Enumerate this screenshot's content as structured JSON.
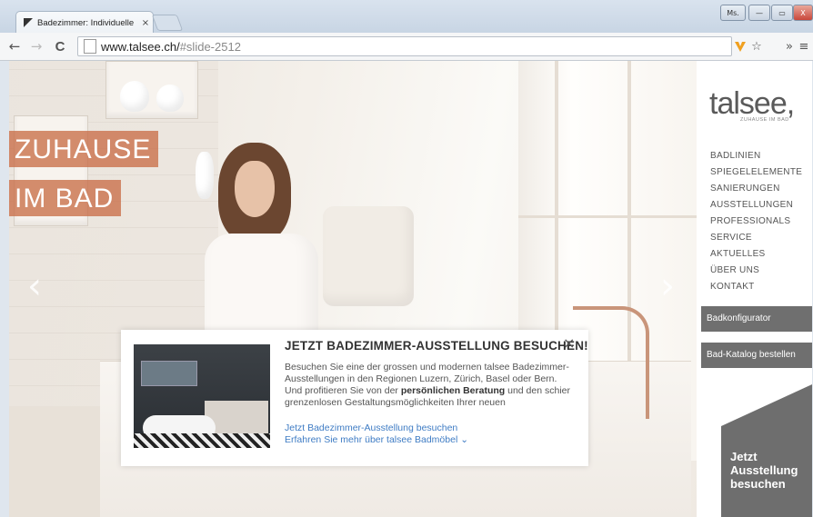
{
  "browser": {
    "tab_title": "Badezimmer: Individuelle",
    "tab_close": "×",
    "url_host": "www.talsee.ch/",
    "url_path": "#slide-2512",
    "window_controls": {
      "user": "Ms.",
      "minimize": "—",
      "maximize": "▭",
      "close": "X"
    },
    "nav": {
      "back": "←",
      "forward": "→",
      "reload": "C"
    },
    "extensions": {
      "star": "☆",
      "more": "»",
      "menu": "≡"
    }
  },
  "hero": {
    "slogan_line1": "ZUHAUSE",
    "slogan_line2": "IM BAD",
    "prev_arrow": "‹",
    "next_arrow": "›"
  },
  "popup": {
    "title": "JETZT BADEZIMMER-AUSSTELLUNG BESUCHEN!",
    "close": "×",
    "body_start": "Besuchen Sie eine der grossen und modernen talsee Badezimmer-Ausstellungen in den Regionen Luzern, Zürich, Basel oder Bern. Und profitieren Sie von der ",
    "body_bold": "persönlichen Beratung",
    "body_end": " und den schier grenzenlosen Gestaltungsmöglichkeiten Ihrer neuen",
    "link1": "Jetzt Badezimmer-Ausstellung besuchen",
    "link2": "Erfahren Sie mehr über talsee Badmöbel"
  },
  "sidebar": {
    "logo": "talsee,",
    "logo_tagline": "ZUHAUSE IM BAD",
    "menu": [
      "BADLINIEN",
      "SPIEGELELEMENTE",
      "SANIERUNGEN",
      "AUSSTELLUNGEN",
      "PROFESSIONALS",
      "SERVICE",
      "AKTUELLES",
      "ÜBER UNS",
      "KONTAKT"
    ],
    "button1": "Badkonfigurator",
    "button2": "Bad-Katalog bestellen",
    "promo_line1": "Jetzt",
    "promo_line2": "Ausstellung",
    "promo_line3": "besuchen"
  },
  "colors": {
    "accent": "#c96e48",
    "link": "#3f7cc4",
    "sidebar_button": "#6f6f6f"
  }
}
